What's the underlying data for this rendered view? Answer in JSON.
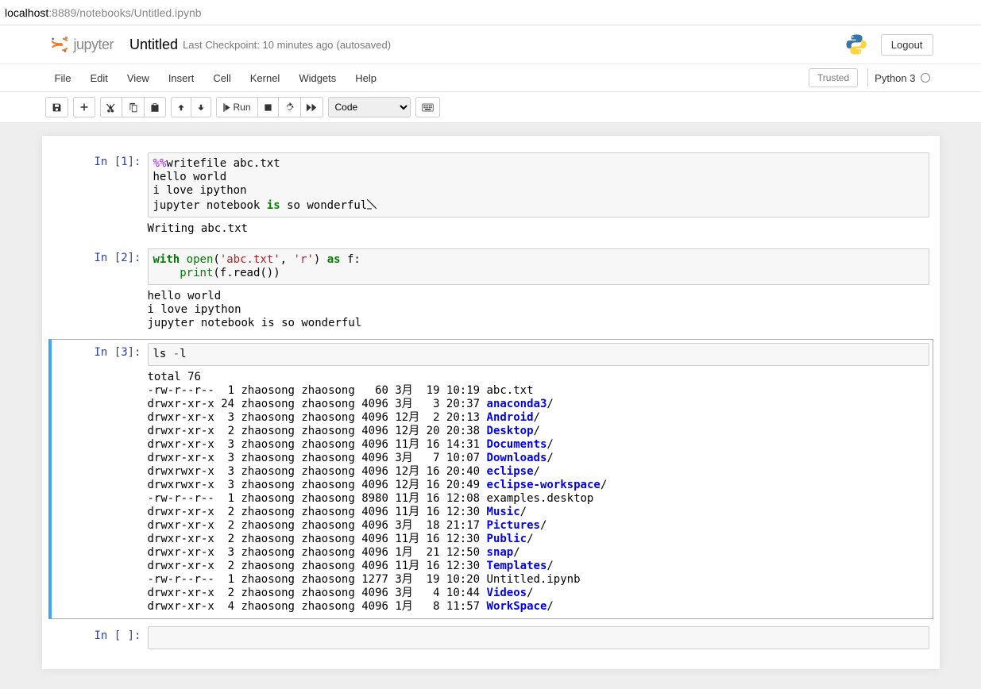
{
  "address_bar": {
    "host": "localhost",
    "path": ":8889/notebooks/Untitled.ipynb"
  },
  "header": {
    "logo_text": "jupyter",
    "notebook_name": "Untitled",
    "checkpoint": "Last Checkpoint: 10 minutes ago",
    "autosave": "(autosaved)",
    "logout": "Logout"
  },
  "menu": {
    "file": "File",
    "edit": "Edit",
    "view": "View",
    "insert": "Insert",
    "cell": "Cell",
    "kernel": "Kernel",
    "widgets": "Widgets",
    "help": "Help",
    "trusted": "Trusted",
    "kernel_name": "Python 3"
  },
  "toolbar": {
    "run": "Run",
    "celltype": "Code"
  },
  "cells": [
    {
      "prompt": "In [1]:",
      "code": {
        "l1_magic": "%%",
        "l1_rest": "writefile abc.txt",
        "l2": "hello world",
        "l3": "i love ipython",
        "l4a": "jupyter notebook ",
        "l4_kw": "is",
        "l4b": " so wonderful"
      },
      "output": "Writing abc.txt"
    },
    {
      "prompt": "In [2]:",
      "code": {
        "kw_with": "with",
        "sp1": " ",
        "fn_open": "open",
        "paren1": "(",
        "str1": "'abc.txt'",
        "comma": ", ",
        "str2": "'r'",
        "paren2": ")",
        "sp2": " ",
        "kw_as": "as",
        "rest1": " f:",
        "indent": "    ",
        "fn_print": "print",
        "rest2": "(f.read())"
      },
      "output": "hello world\ni love ipython\njupyter notebook is so wonderful"
    },
    {
      "prompt": "In [3]:",
      "code": {
        "cmd": "ls ",
        "flag": "-",
        "l": "l"
      },
      "output": {
        "l0": "total 76",
        "l1": "-rw-r--r--  1 zhaosong zhaosong   60 3月  19 10:19 abc.txt",
        "l2a": "drwxr-xr-x 24 zhaosong zhaosong 4096 3月   3 20:37 ",
        "l2b": "anaconda3",
        "l2c": "/",
        "l3a": "drwxr-xr-x  3 zhaosong zhaosong 4096 12月  2 20:13 ",
        "l3b": "Android",
        "l3c": "/",
        "l4a": "drwxr-xr-x  2 zhaosong zhaosong 4096 12月 20 20:38 ",
        "l4b": "Desktop",
        "l4c": "/",
        "l5a": "drwxr-xr-x  3 zhaosong zhaosong 4096 11月 16 14:31 ",
        "l5b": "Documents",
        "l5c": "/",
        "l6a": "drwxr-xr-x  3 zhaosong zhaosong 4096 3月   7 10:07 ",
        "l6b": "Downloads",
        "l6c": "/",
        "l7a": "drwxrwxr-x  3 zhaosong zhaosong 4096 12月 16 20:40 ",
        "l7b": "eclipse",
        "l7c": "/",
        "l8a": "drwxrwxr-x  3 zhaosong zhaosong 4096 12月 16 20:49 ",
        "l8b": "eclipse-workspace",
        "l8c": "/",
        "l9": "-rw-r--r--  1 zhaosong zhaosong 8980 11月 16 12:08 examples.desktop",
        "l10a": "drwxr-xr-x  2 zhaosong zhaosong 4096 11月 16 12:30 ",
        "l10b": "Music",
        "l10c": "/",
        "l11a": "drwxr-xr-x  2 zhaosong zhaosong 4096 3月  18 21:17 ",
        "l11b": "Pictures",
        "l11c": "/",
        "l12a": "drwxr-xr-x  2 zhaosong zhaosong 4096 11月 16 12:30 ",
        "l12b": "Public",
        "l12c": "/",
        "l13a": "drwxr-xr-x  3 zhaosong zhaosong 4096 1月  21 12:50 ",
        "l13b": "snap",
        "l13c": "/",
        "l14a": "drwxr-xr-x  2 zhaosong zhaosong 4096 11月 16 12:30 ",
        "l14b": "Templates",
        "l14c": "/",
        "l15": "-rw-r--r--  1 zhaosong zhaosong 1277 3月  19 10:20 Untitled.ipynb",
        "l16a": "drwxr-xr-x  2 zhaosong zhaosong 4096 3月   4 10:44 ",
        "l16b": "Videos",
        "l16c": "/",
        "l17a": "drwxr-xr-x  4 zhaosong zhaosong 4096 1月   8 11:57 ",
        "l17b": "WorkSpace",
        "l17c": "/"
      }
    },
    {
      "prompt": "In [ ]:"
    }
  ]
}
